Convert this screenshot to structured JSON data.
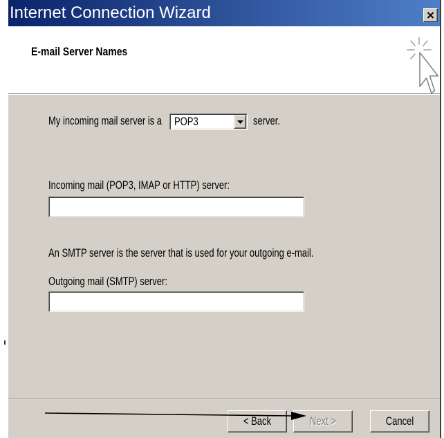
{
  "window": {
    "title": "Internet Connection Wizard",
    "close_icon": "close-icon"
  },
  "header": {
    "title": "E-mail Server Names",
    "icon": "wizard-cursor-sparkle-icon"
  },
  "form": {
    "server_type_prefix": "My incoming mail server is a",
    "server_type_value": "POP3",
    "server_type_dropdown_icon": "chevron-down-icon",
    "server_type_suffix": "server.",
    "incoming_label": "Incoming mail (POP3, IMAP or HTTP) server:",
    "incoming_value": "",
    "smtp_note": "An SMTP server is the server that is used for your outgoing e-mail.",
    "outgoing_label": "Outgoing mail (SMTP) server:",
    "outgoing_value": ""
  },
  "buttons": {
    "back": "< Back",
    "next": "Next >",
    "next_enabled": false,
    "cancel": "Cancel"
  },
  "annotation": {
    "icon": "arrow-right-icon"
  },
  "colors": {
    "title_bar_start": "#0a246a",
    "title_bar_end": "#4f7fc8",
    "title_text": "#ffffff",
    "dialog_face": "#d4d0c8",
    "header_background": "#ffffff",
    "disabled_text": "#808080",
    "annotation_arrow": "#000000"
  }
}
